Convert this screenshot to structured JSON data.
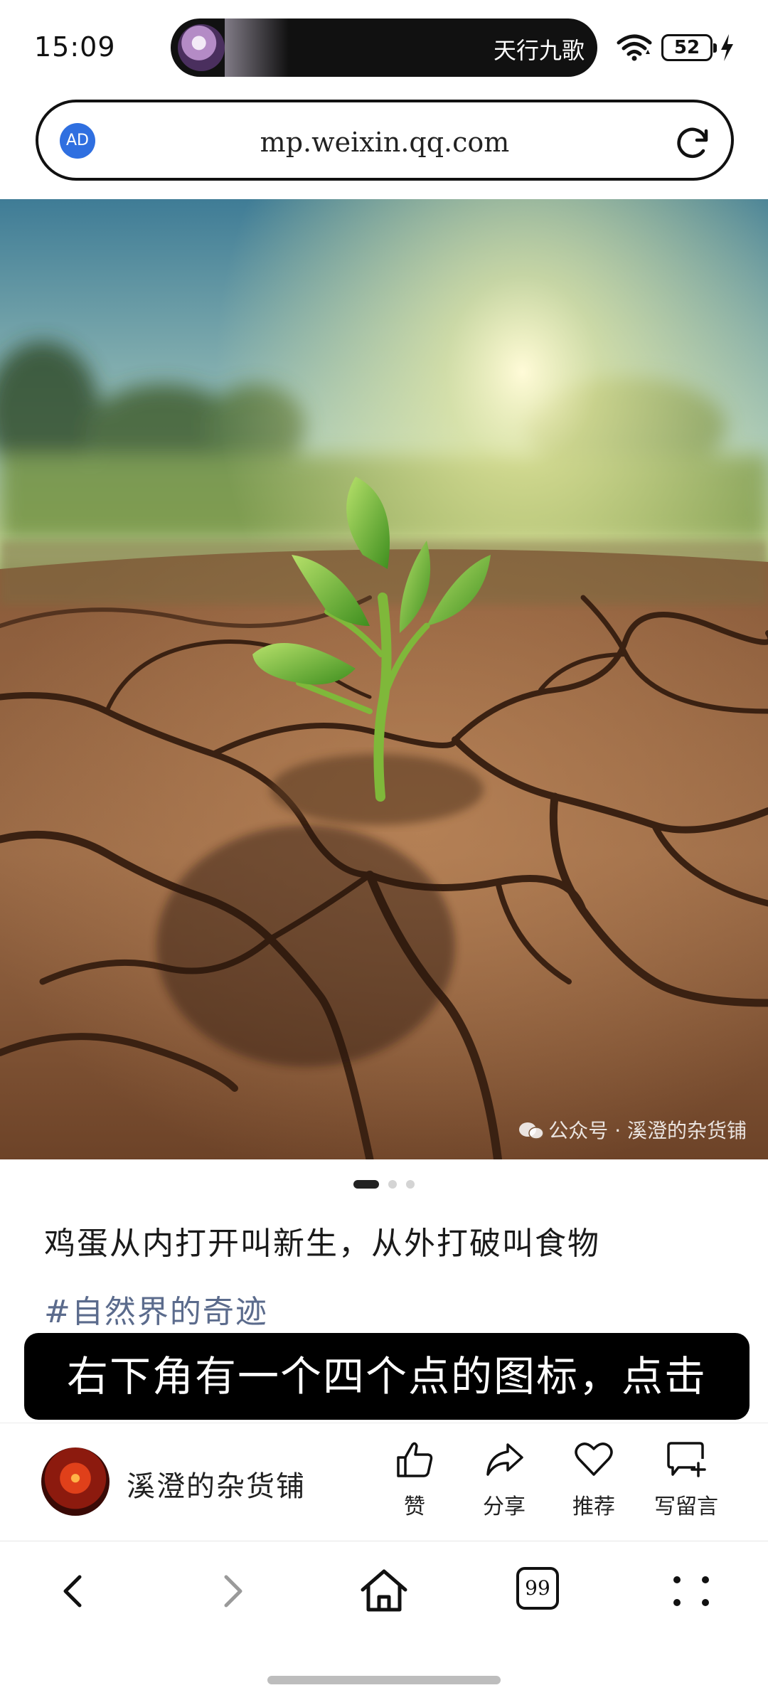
{
  "status_bar": {
    "time": "15:09",
    "island_text": "天行九歌",
    "battery": "52",
    "icons": [
      "wifi-icon",
      "battery-icon",
      "charging-icon"
    ]
  },
  "address_bar": {
    "ad_badge": "AD",
    "url": "mp.weixin.qq.com",
    "reload_icon": "reload-icon"
  },
  "hero": {
    "watermark": "公众号 · 溪澄的杂货铺",
    "carousel": {
      "total": 3,
      "active": 1
    }
  },
  "article": {
    "title": "鸡蛋从内打开叫新生，从外打破叫食物",
    "hashtag": "#自然界的奇迹"
  },
  "caption": "右下角有一个四个点的图标，点击",
  "author": {
    "name": "溪澄的杂货铺"
  },
  "actions": {
    "like": "赞",
    "share": "分享",
    "recommend": "推荐",
    "comment": "写留言"
  },
  "bottom_nav": {
    "tabs_count": "99",
    "icons": [
      "back-icon",
      "forward-icon",
      "home-icon",
      "tabs-icon",
      "more-icon"
    ]
  },
  "colors": {
    "accent_blue": "#2f6fe0",
    "hashtag": "#5b6b8c",
    "caption_bg": "#000000"
  }
}
